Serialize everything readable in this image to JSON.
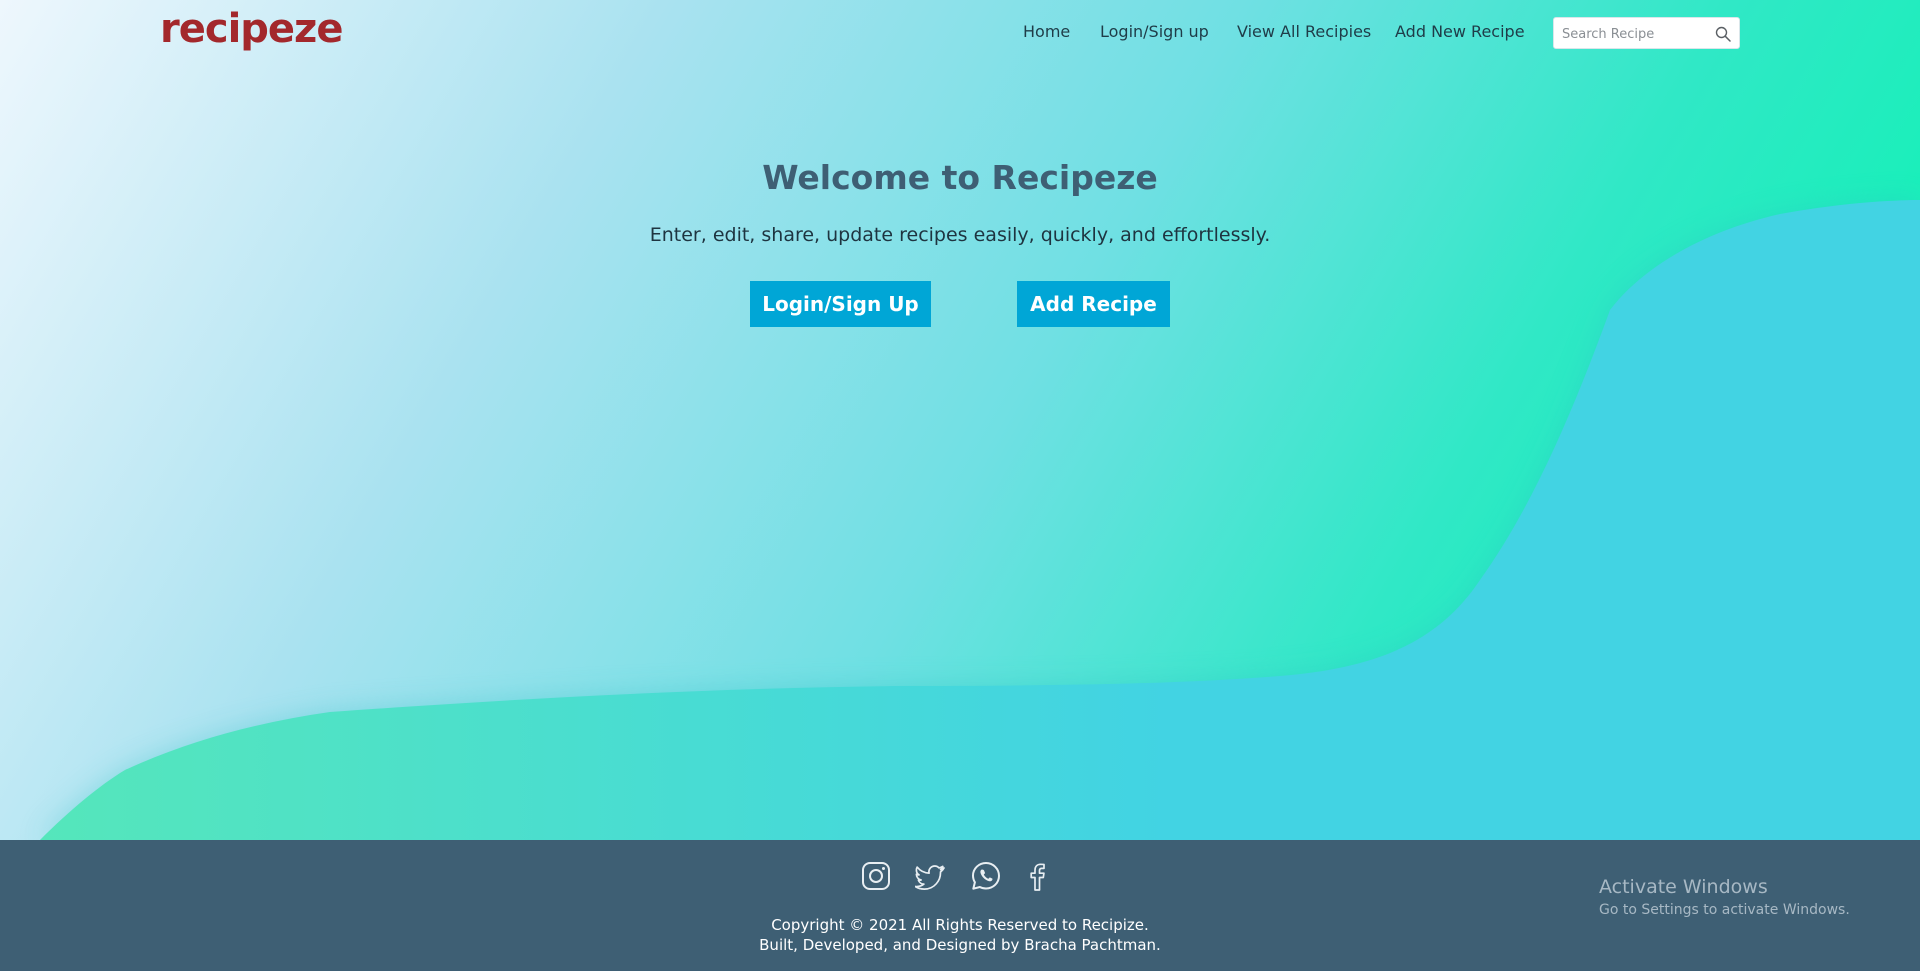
{
  "brand": {
    "logo": "recipeze",
    "logo_color": "#a3282c"
  },
  "nav": {
    "items": [
      {
        "label": "Home"
      },
      {
        "label": "Login/Sign up"
      },
      {
        "label": "View All Recipies"
      },
      {
        "label": "Add New Recipe"
      }
    ],
    "search": {
      "placeholder": "Search Recipe",
      "icon": "search-icon"
    }
  },
  "hero": {
    "title": "Welcome to Recipeze",
    "tagline": "Enter, edit, share, update recipes easily, quickly, and effortlessly.",
    "buttons": [
      {
        "label": "Login/Sign Up"
      },
      {
        "label": "Add Recipe"
      }
    ],
    "button_color": "#00a6d6"
  },
  "footer": {
    "social_icons": [
      "instagram-icon",
      "twitter-icon",
      "whatsapp-icon",
      "facebook-icon"
    ],
    "copyright": "Copyright © 2021 All Rights Reserved to Recipize.",
    "credits": "Built, Developed, and Designed by Bracha Pachtman.",
    "background": "#3e5f74"
  },
  "watermark": {
    "title": "Activate Windows",
    "subtitle": "Go to Settings to activate Windows."
  }
}
